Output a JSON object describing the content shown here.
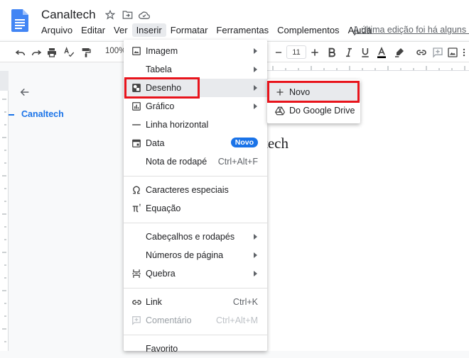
{
  "header": {
    "title": "Canaltech",
    "last_edit": "A última edição foi há alguns seg",
    "menus": [
      "Arquivo",
      "Editar",
      "Ver",
      "Inserir",
      "Formatar",
      "Ferramentas",
      "Complementos",
      "Ajuda"
    ],
    "active_menu": "Inserir"
  },
  "toolbar": {
    "zoom": "100%",
    "font_size": "11",
    "icons": [
      "undo-icon",
      "redo-icon",
      "print-icon",
      "spellcheck-icon",
      "paint-format-icon",
      "minus-icon",
      "plus-icon",
      "bold-icon",
      "italic-icon",
      "underline-icon",
      "text-color-icon",
      "highlight-icon",
      "link-icon",
      "comment-icon",
      "image-icon",
      "more-icon"
    ]
  },
  "outline": {
    "heading": "Canaltech"
  },
  "document": {
    "text": "tech"
  },
  "insert_menu": {
    "items": [
      {
        "label": "Imagem",
        "icon": "image-icon",
        "submenu": true
      },
      {
        "label": "Tabela",
        "submenu": true
      },
      {
        "label": "Desenho",
        "icon": "drawing-icon",
        "submenu": true,
        "highlighted": true
      },
      {
        "label": "Gráfico",
        "icon": "chart-icon",
        "submenu": true
      },
      {
        "label": "Linha horizontal",
        "icon": "horizontal-line-icon"
      },
      {
        "label": "Data",
        "icon": "calendar-icon",
        "badge": "Novo"
      },
      {
        "label": "Nota de rodapé",
        "shortcut": "Ctrl+Alt+F"
      },
      {
        "label": "Caracteres especiais",
        "icon": "omega-icon"
      },
      {
        "label": "Equação",
        "icon": "pi-icon"
      },
      {
        "label": "Cabeçalhos e rodapés",
        "submenu": true
      },
      {
        "label": "Números de página",
        "submenu": true
      },
      {
        "label": "Quebra",
        "icon": "page-break-icon",
        "submenu": true
      },
      {
        "label": "Link",
        "icon": "link-icon",
        "shortcut": "Ctrl+K"
      },
      {
        "label": "Comentário",
        "icon": "comment-icon",
        "shortcut": "Ctrl+Alt+M",
        "disabled": true
      },
      {
        "label": "Favorito"
      }
    ]
  },
  "drawing_submenu": {
    "items": [
      {
        "label": "Novo",
        "icon": "plus-icon",
        "highlighted": true
      },
      {
        "label": "Do Google Drive",
        "icon": "google-drive-icon"
      }
    ]
  },
  "colors": {
    "accent": "#1a73e8",
    "highlight_box": "#e8141c",
    "docs_blue": "#4285f4"
  }
}
